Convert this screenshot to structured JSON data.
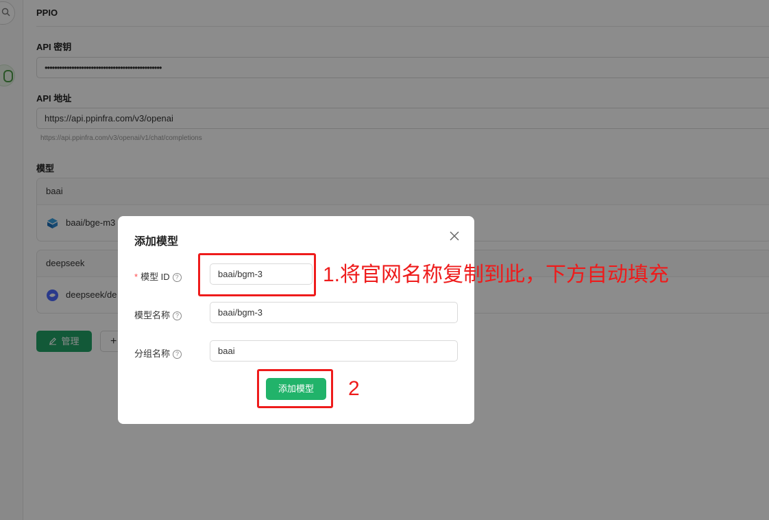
{
  "provider": {
    "name": "PPIO",
    "api_key_label": "API 密钥",
    "api_key_value": "••••••••••••••••••••••••••••••••••••••••••••••••",
    "api_url_label": "API 地址",
    "api_url_value": "https://api.ppinfra.com/v3/openai",
    "api_url_hint": "https://api.ppinfra.com/v3/openai/v1/chat/completions",
    "models_label": "模型",
    "groups": [
      {
        "name": "baai",
        "model": "baai/bge-m3",
        "icon": "baai-cube-icon"
      },
      {
        "name": "deepseek",
        "model": "deepseek/de",
        "icon": "deepseek-whale-icon"
      }
    ],
    "manage_button": "管理",
    "add_button_icon": "plus-icon"
  },
  "modal": {
    "title": "添加模型",
    "close_icon": "close-icon",
    "fields": {
      "model_id_label": "模型 ID",
      "model_id_value": "baai/bgm-3",
      "model_name_label": "模型名称",
      "model_name_value": "baai/bgm-3",
      "group_name_label": "分组名称",
      "group_name_value": "baai"
    },
    "help_icon": "question-circle-icon",
    "submit_button": "添加模型"
  },
  "annotations": {
    "step1": "1.将官网名称复制到此，下方自动填充",
    "step2": "2",
    "color": "#ee1b1b"
  },
  "colors": {
    "accent": "#21b36a",
    "required": "#ff4d4f"
  }
}
